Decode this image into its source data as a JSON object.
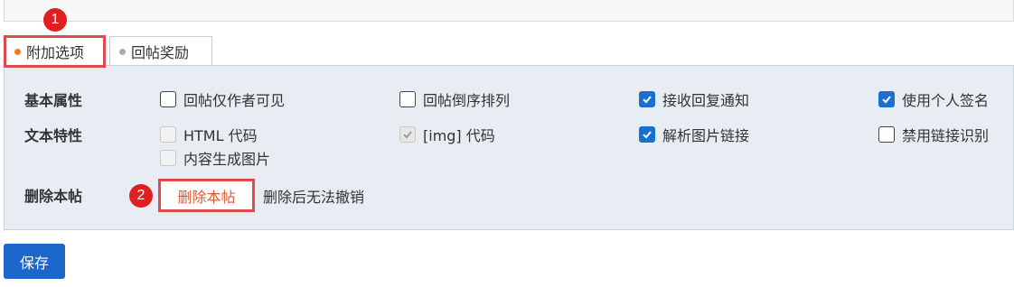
{
  "tabs": [
    {
      "label": "附加选项",
      "active": true
    },
    {
      "label": "回帖奖励",
      "active": false
    }
  ],
  "badges": [
    "1",
    "2"
  ],
  "rows": {
    "basic": {
      "label": "基本属性",
      "options": [
        {
          "label": "回帖仅作者可见",
          "checked": false,
          "disabled": false
        },
        {
          "label": "回帖倒序排列",
          "checked": false,
          "disabled": false
        },
        {
          "label": "接收回复通知",
          "checked": true,
          "disabled": false
        },
        {
          "label": "使用个人签名",
          "checked": true,
          "disabled": false
        }
      ]
    },
    "text": {
      "label": "文本特性",
      "options": [
        {
          "label": "HTML 代码",
          "checked": false,
          "disabled": true
        },
        {
          "label": "[img] 代码",
          "checked": true,
          "disabled": true
        },
        {
          "label": "解析图片链接",
          "checked": true,
          "disabled": false
        },
        {
          "label": "禁用链接识别",
          "checked": false,
          "disabled": false
        },
        {
          "label": "内容生成图片",
          "checked": false,
          "disabled": true
        }
      ]
    },
    "delete": {
      "label": "删除本帖",
      "button_label": "删除本帖",
      "note": "删除后无法撤销"
    }
  },
  "save_label": "保存",
  "colors": {
    "accent_blue": "#1c67c9",
    "highlight_red": "#e04a4a",
    "panel_bg": "#e7edf3",
    "tab_dot_active": "#f07c22",
    "delete_text": "#e05a3a"
  }
}
